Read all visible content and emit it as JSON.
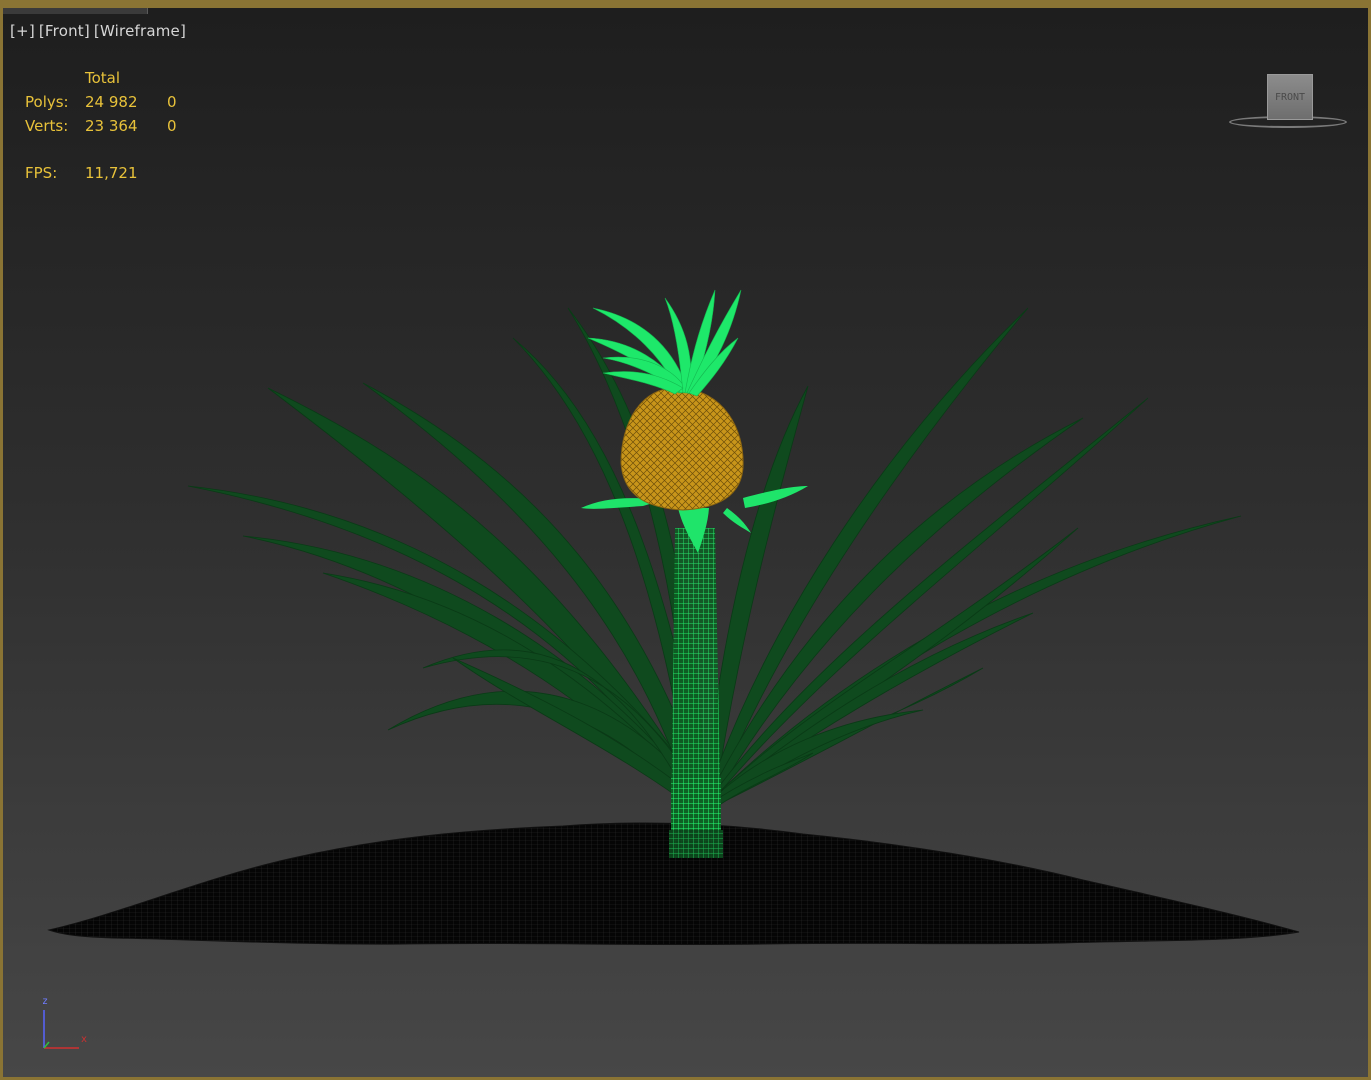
{
  "viewport": {
    "label_plus": "[+]",
    "label_view": "[Front]",
    "label_shading": "[Wireframe]"
  },
  "stats": {
    "header": "Total",
    "rows": [
      {
        "label": "Polys:",
        "total": "24 982",
        "selected": "0"
      },
      {
        "label": "Verts:",
        "total": "23 364",
        "selected": "0"
      }
    ],
    "fps_label": "FPS:",
    "fps_value": "11,721"
  },
  "viewcube": {
    "face_label": "FRONT"
  },
  "axis": {
    "z": "z",
    "x": "x"
  },
  "colors": {
    "border": "#8a7434",
    "stats_text": "#e8c23a",
    "leaves": "#0f4a1e",
    "crown": "#1ee86a",
    "fruit": "#c8951a",
    "ground": "#050505"
  }
}
